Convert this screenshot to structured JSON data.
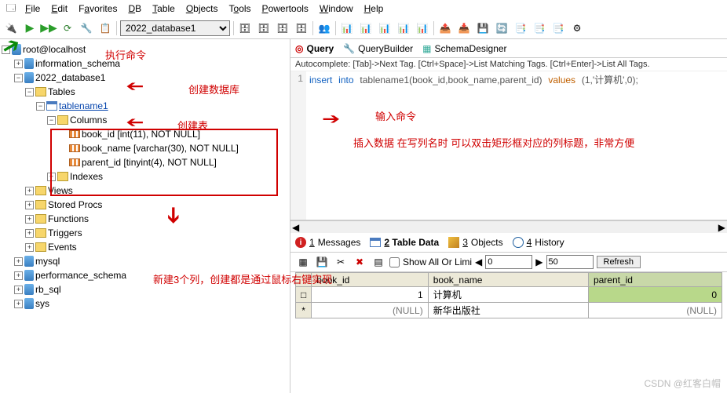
{
  "menu": {
    "file": "File",
    "edit": "Edit",
    "favorites": "Favorites",
    "db": "DB",
    "table": "Table",
    "objects": "Objects",
    "tools": "Tools",
    "powertools": "Powertools",
    "window": "Window",
    "help": "Help"
  },
  "toolbar": {
    "db_combo": "2022_database1"
  },
  "tree": {
    "root": "root@localhost",
    "info_schema": "information_schema",
    "db": "2022_database1",
    "tables": "Tables",
    "tablename": "tablename1",
    "columns": "Columns",
    "col1": "book_id [int(11), NOT NULL]",
    "col2": "book_name [varchar(30), NOT NULL]",
    "col3": "parent_id [tinyint(4), NOT NULL]",
    "indexes": "Indexes",
    "views": "Views",
    "stored": "Stored Procs",
    "functions": "Functions",
    "triggers": "Triggers",
    "events": "Events",
    "mysql": "mysql",
    "perf": "performance_schema",
    "rbsql": "rb_sql",
    "sys": "sys"
  },
  "tabs": {
    "query": "Query",
    "qb": "QueryBuilder",
    "sd": "SchemaDesigner"
  },
  "autocomplete": "Autocomplete: [Tab]->Next Tag. [Ctrl+Space]->List Matching Tags. [Ctrl+Enter]->List All Tags.",
  "sql": {
    "lineno": "1",
    "insert": "insert",
    "into": "into",
    "tbl": "tablename1",
    "args": "(book_id,book_name,parent_id)",
    "values": "values",
    "vals": "(1,'计算机',0);"
  },
  "result_tabs": {
    "messages": "Messages",
    "tabledata": "Table Data",
    "objects": "Objects",
    "history": "History",
    "n1": "1",
    "n2": "2",
    "n3": "3",
    "n4": "4"
  },
  "data_toolbar": {
    "showall": "Show All Or  Limi",
    "from": "0",
    "to": "50",
    "refresh": "Refresh"
  },
  "grid": {
    "headers": {
      "bookid": "book_id",
      "bookname": "book_name",
      "parentid": "parent_id"
    },
    "r1": {
      "marker": "□",
      "id": "1",
      "name": "计算机",
      "pid": "0"
    },
    "r2": {
      "marker": "*",
      "id": "(NULL)",
      "name": "新华出版社",
      "pid": "(NULL)"
    }
  },
  "notes": {
    "exec": "执行命令",
    "createdb": "创建数据库",
    "createtbl": "创建表",
    "input": "输入命令",
    "insertdesc": "插入数据  在写列名时  可以双击矩形框对应的列标题，非常方便",
    "newcols": "新建3个列，创建都是通过鼠标右键实现"
  },
  "watermark": "CSDN @红客白帽"
}
